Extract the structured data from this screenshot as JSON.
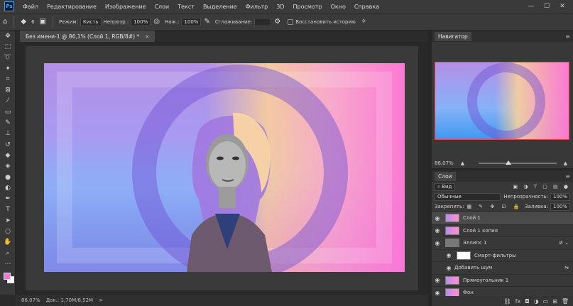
{
  "app": {
    "logo": "Ps",
    "menu": [
      "Файл",
      "Редактирование",
      "Изображение",
      "Слои",
      "Текст",
      "Выделение",
      "Фильтр",
      "3D",
      "Просмотр",
      "Окно",
      "Справка"
    ],
    "window_controls": [
      "—",
      "☐",
      "✕"
    ]
  },
  "options": {
    "brush_size": "6",
    "mode_label": "Режим:",
    "mode_value": "Кисть",
    "opacity_label": "Непрозр.:",
    "opacity_value": "100%",
    "pressure_label": "Наж.:",
    "pressure_value": "100%",
    "smoothing_label": "Сглаживание:",
    "erase_history_label": "Восстановить историю"
  },
  "document": {
    "tab_title": "Без имени-1 @ 86,1% (Слой 1, RGB/8#) *",
    "close": "×"
  },
  "status": {
    "zoom": "86,07%",
    "doc": "Док.: 1,70M/8,52M",
    "arrow": ">"
  },
  "navigator": {
    "title": "Навигатор",
    "zoom": "86,07%"
  },
  "layers": {
    "title": "Слои",
    "filter_label": "Вид",
    "blend_mode": "Обычные",
    "opacity_label": "Непрозрачность:",
    "opacity_value": "100%",
    "lock_label": "Закрепить:",
    "fill_label": "Заливка:",
    "fill_value": "100%",
    "items": [
      {
        "name": "Слой 1",
        "active": true
      },
      {
        "name": "Слой 1 копия",
        "active": false
      },
      {
        "name": "Эллипс 1",
        "active": false
      },
      {
        "name": "Смарт-фильтры",
        "active": false
      },
      {
        "name": "Добавить шум",
        "active": false
      },
      {
        "name": "Прямоугольник 1",
        "active": false
      },
      {
        "name": "Фон",
        "active": false
      }
    ]
  },
  "colors": {
    "foreground": "#f07ad8",
    "background": "#ffffff",
    "accent": "#31a8ff"
  }
}
